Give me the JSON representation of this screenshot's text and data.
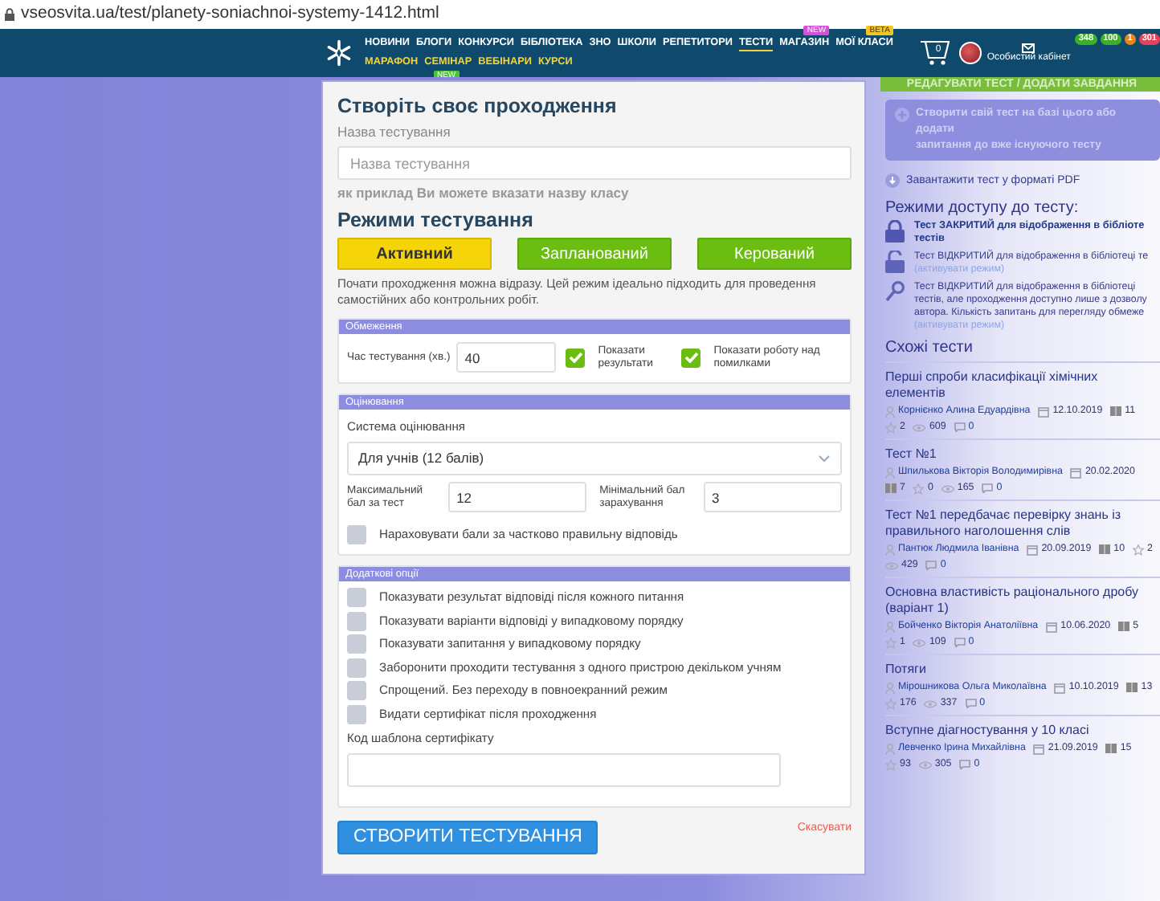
{
  "browser": {
    "url": "vseosvita.ua/test/planety-soniachnoi-systemy-1412.html"
  },
  "nav": {
    "rows": [
      [
        {
          "label": "НОВИНИ",
          "selected": false
        },
        {
          "label": "БЛОГИ",
          "selected": false
        },
        {
          "label": "КОНКУРСИ",
          "selected": false
        },
        {
          "label": "БІБЛІОТЕКА",
          "selected": false
        },
        {
          "label": "ЗНО",
          "selected": false
        },
        {
          "label": "ШКОЛИ",
          "selected": false
        },
        {
          "label": "РЕПЕТИТОРИ",
          "selected": false
        },
        {
          "label": "ТЕСТИ",
          "selected": true
        },
        {
          "label": "МАГАЗИН",
          "selected": false,
          "badge": "NEW",
          "color": "#d64fd8"
        },
        {
          "label": "МОЇ КЛАСИ",
          "selected": false,
          "badge": "BETA",
          "color": "#f2c61f"
        }
      ],
      [
        {
          "label": "МАРАФОН",
          "selected": false
        },
        {
          "label": "СЕМІНАР",
          "selected": false,
          "badge": "NEW",
          "color": "#4cc43a"
        },
        {
          "label": "ВЕБІНАРИ",
          "selected": false
        },
        {
          "label": "КУРСИ",
          "selected": false
        }
      ]
    ],
    "cart_count": "0",
    "account_label": "Особистий кабінет",
    "counters": [
      {
        "value": "348",
        "color": "#3fae2a"
      },
      {
        "value": "100",
        "color": "#3fae2a"
      },
      {
        "value": "1",
        "color": "#e8861c"
      },
      {
        "value": "301",
        "color": "#e8405a"
      }
    ]
  },
  "modal": {
    "title": "Створіть своє проходження",
    "name_label": "Назва тестування",
    "name_placeholder": "Назва тестування",
    "hint": "як приклад Ви можете вказати назву класу",
    "modes_title": "Режими тестування",
    "modes": [
      {
        "label": "Активний",
        "selected": true
      },
      {
        "label": "Запланований",
        "selected": false
      },
      {
        "label": "Керований",
        "selected": false
      }
    ],
    "mode_description": "Почати проходження можна відразу. Цей режим ідеально підходить для проведення самостійних або контрольних робіт.",
    "limits": {
      "header": "Обмеження",
      "time_label": "Час тестування (хв.)",
      "time_value": "40",
      "checks": [
        {
          "label": "Показати результати",
          "checked": true
        },
        {
          "label": "Показати роботу над помилками",
          "checked": true
        }
      ]
    },
    "grading": {
      "header": "Оцінювання",
      "system_label": "Система оцінювання",
      "system_value": "Для учнів (12 балів)",
      "max_label": "Максимальний бал за тест",
      "max_value": "12",
      "min_label": "Мінімальний бал зарахування",
      "min_value": "3",
      "partial": {
        "label": "Нараховувати бали за частково правильну відповідь",
        "checked": false
      }
    },
    "extra": {
      "header": "Додаткові опції",
      "options": [
        {
          "label": "Показувати результат відповіді після кожного питання",
          "checked": false
        },
        {
          "label": "Показувати варіанти відповіді у випадковому порядку",
          "checked": false
        },
        {
          "label": "Показувати запитання у випадковому порядку",
          "checked": false
        },
        {
          "label": "Заборонити проходити тестування з одного пристрою декільком учням",
          "checked": false
        },
        {
          "label": "Спрощений. Без переходу в повноекранний режим",
          "checked": false
        },
        {
          "label": "Видати сертифікат після проходження",
          "checked": false
        }
      ],
      "cert_label": "Код шаблона сертифікату"
    },
    "submit": "СТВОРИТИ ТЕСТУВАННЯ",
    "cancel": "Скасувати"
  },
  "sidebar": {
    "edit_button": "РЕДАГУВАТИ ТЕСТ / ДОДАТИ ЗАВДАННЯ",
    "create_box": [
      "Створити свій тест на базі цього або додати",
      "запитання до вже існуючого тесту"
    ],
    "pdf_link": "Завантажити тест у форматі PDF",
    "access_title": "Режими доступу до тесту:",
    "access_modes": [
      {
        "kind": "closed",
        "lines": [
          "Тест ЗАКРИТИЙ для відображення в бібліоте",
          "тестів"
        ]
      },
      {
        "kind": "open",
        "lines": [
          "Тест ВІДКРИТИЙ для відображення в бібліотеці те"
        ],
        "link": "(активувати режим)"
      },
      {
        "kind": "limited",
        "lines": [
          "Тест ВІДКРИТИЙ для відображення в бібліотеці",
          "тестів, але проходження доступно лише з дозволу",
          "автора. Кількість запитань для перегляду обмеже"
        ],
        "link": "(активувати режим)"
      }
    ],
    "similar_title": "Схожі тести",
    "tests": [
      {
        "title": "Перші спроби класифікації хімічних елементів",
        "author": "Корнієнко Алина Едуардівна",
        "date": "12.10.2019",
        "questions": "11",
        "stars": "2",
        "views": "609",
        "comments": "0"
      },
      {
        "title": "Тест №1",
        "author": "Шпилькова Вікторія Володимирівна",
        "date": "20.02.2020",
        "questions": "7",
        "stars": "0",
        "views": "165",
        "comments": "0"
      },
      {
        "title": "Тест №1 передбачає перевірку знань із правильного наголошення слів",
        "author": "Пантюк Людмила Іванівна",
        "date": "20.09.2019",
        "questions": "10",
        "stars": "2",
        "views": "429",
        "comments": "0"
      },
      {
        "title": "Основна властивість раціонального дробу (варіант 1)",
        "author": "Бойченко Вікторія Анатоліївна",
        "date": "10.06.2020",
        "questions": "5",
        "stars": "1",
        "views": "109",
        "comments": "0"
      },
      {
        "title": "Потяги",
        "author": "Мірошникова Ольга Миколаївна",
        "date": "10.10.2019",
        "questions": "13",
        "stars": "176",
        "views": "337",
        "comments": "0"
      },
      {
        "title": "Вступне діагностування у 10 класі",
        "author": "Левченко Ірина Михайлівна",
        "date": "21.09.2019",
        "questions": "15",
        "stars": "93",
        "views": "305",
        "comments": "0"
      }
    ]
  }
}
